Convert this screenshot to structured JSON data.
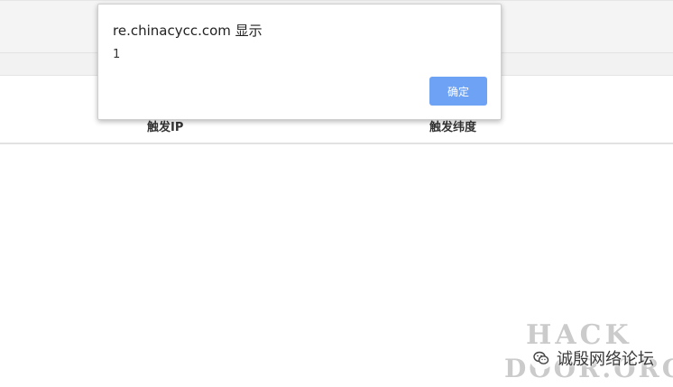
{
  "dialog": {
    "title": "re.chinacycc.com 显示",
    "message": "1",
    "ok_label": "确定",
    "ok_color": "#6ea2f4"
  },
  "table": {
    "headers": [
      "触发IP",
      "触发纬度"
    ]
  },
  "watermark": {
    "line1": "HACK",
    "line2": "DOOR.ORG",
    "label": "诚殷网络论坛",
    "icon": "wechat-icon"
  }
}
